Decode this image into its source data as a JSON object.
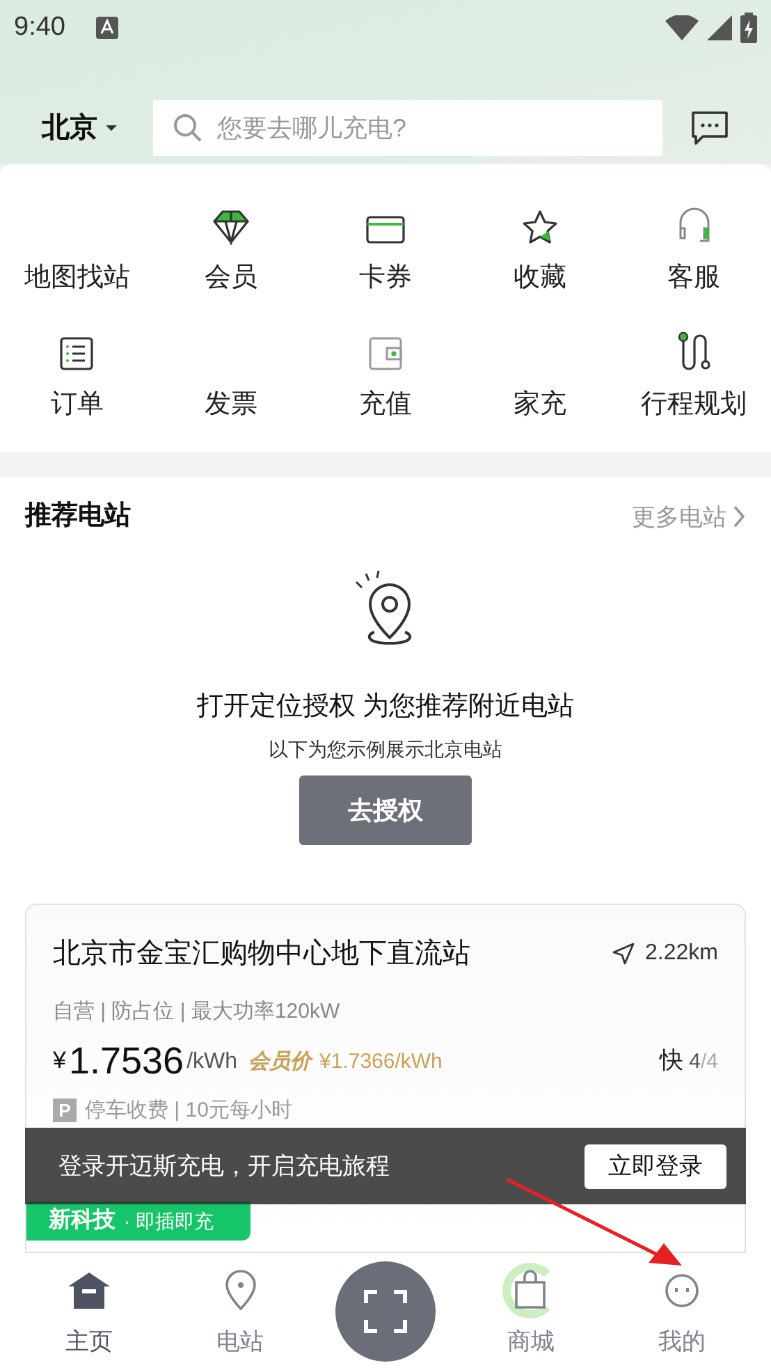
{
  "status_bar": {
    "time": "9:40"
  },
  "header": {
    "city": "北京",
    "search": {
      "placeholder": "您要去哪儿充电?"
    }
  },
  "shortcuts": [
    {
      "label": "地图找站",
      "icon": false
    },
    {
      "label": "会员",
      "icon": true
    },
    {
      "label": "卡券",
      "icon": true
    },
    {
      "label": "收藏",
      "icon": true
    },
    {
      "label": "客服",
      "icon": true
    },
    {
      "label": "订单",
      "icon": true
    },
    {
      "label": "发票",
      "icon": false
    },
    {
      "label": "充值",
      "icon": true
    },
    {
      "label": "家充",
      "icon": false
    },
    {
      "label": "行程规划",
      "icon": true
    }
  ],
  "recommend": {
    "title": "推荐电站",
    "more": "更多电站",
    "prompt": "打开定位授权 为您推荐附近电站",
    "note": "以下为您示例展示北京电站",
    "button": "去授权"
  },
  "station": {
    "name": "北京市金宝汇购物中心地下直流站",
    "distance": "2.22km",
    "tags": "自营 | 防占位 | 最大功率120kW",
    "currency": "¥",
    "price": "1.7536",
    "unit": "/kWh",
    "member_label": "会员价",
    "member_price": "¥1.7366/kWh",
    "fast_label": "快",
    "fast_free": "4",
    "fast_total": "/4",
    "parking_icon": "P",
    "parking": "停车收费 | 10元每小时",
    "promo": "新科技",
    "promo_note": "· 即插即充"
  },
  "login_banner": {
    "text": "登录开迈斯充电，开启充电旅程",
    "button": "立即登录"
  },
  "bottom_nav": [
    {
      "label": "主页",
      "selected": true
    },
    {
      "label": "电站",
      "selected": false
    },
    {
      "label": "商城",
      "selected": false
    },
    {
      "label": "我的",
      "selected": false
    }
  ]
}
